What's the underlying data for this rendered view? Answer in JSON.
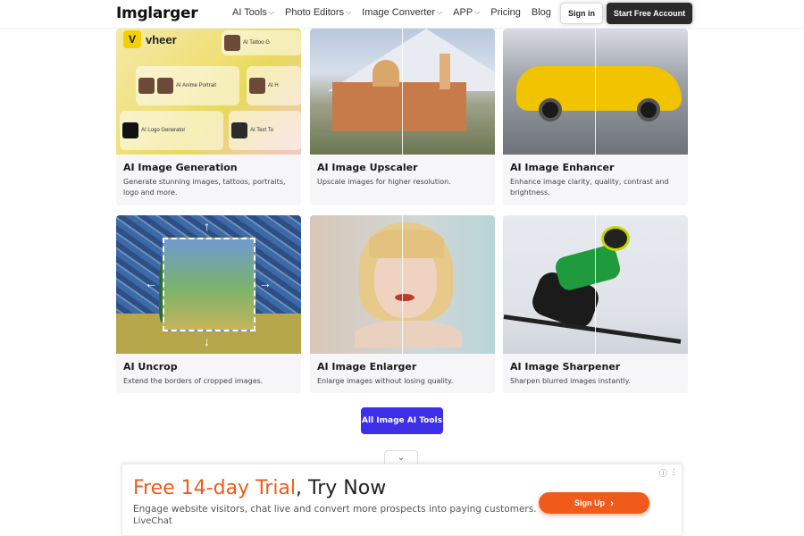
{
  "header": {
    "logo": "Imglarger",
    "nav": [
      {
        "label": "AI Tools",
        "dropdown": true
      },
      {
        "label": "Photo Editors",
        "dropdown": true
      },
      {
        "label": "Image Converter",
        "dropdown": true
      },
      {
        "label": "APP",
        "dropdown": true
      },
      {
        "label": "Pricing",
        "dropdown": false
      },
      {
        "label": "Blog",
        "dropdown": false
      }
    ],
    "signin_label": "Sign in",
    "start_label": "Start Free Account"
  },
  "cards": [
    {
      "title": "AI Image Generation",
      "desc": "Generate stunning images, tattoos, portraits, logo and more."
    },
    {
      "title": "AI Image Upscaler",
      "desc": "Upscale images for higher resolution."
    },
    {
      "title": "AI Image Enhancer",
      "desc": "Enhance image clarity, quality, contrast and brightness."
    },
    {
      "title": "AI Uncrop",
      "desc": "Extend the borders of cropped images."
    },
    {
      "title": "AI Image Enlarger",
      "desc": "Enlarge images without losing quality."
    },
    {
      "title": "AI Image Sharpener",
      "desc": "Sharpen blurred images instantly."
    }
  ],
  "generation_preview": {
    "brand": "vheer",
    "brand_badge": "V",
    "tiles": [
      "AI Tattoo G",
      "AI Anime Portrait",
      "AI H",
      "AI Logo Generator",
      "AI Text To"
    ]
  },
  "all_tools_label": "All Image AI Tools",
  "ad": {
    "headline_highlight": "Free 14-day Trial",
    "headline_rest": ", Try Now",
    "subtext": "Engage website visitors, chat live and convert more prospects into paying customers.",
    "brand": "LiveChat",
    "cta_label": "Sign Up",
    "cta_arrow": "›",
    "toggle_icon": "⌄",
    "info_icon": "ⓘ",
    "menu_icon": "⋮"
  },
  "colors": {
    "accent": "#3d2ee8",
    "ad_orange": "#f05a1a",
    "dark_button": "#2a2a2a"
  }
}
